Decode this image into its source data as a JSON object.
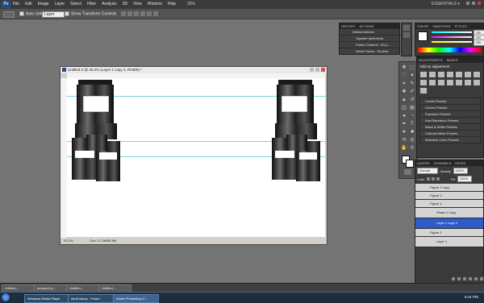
{
  "menubar": {
    "logo": "Ps",
    "items": [
      "File",
      "Edit",
      "Image",
      "Layer",
      "Select",
      "Filter",
      "Analysis",
      "3D",
      "View",
      "Window",
      "Help"
    ],
    "zoom": "25%",
    "workspace": "ESSENTIALS ▾"
  },
  "optbar": {
    "auto_select_label": "Auto-Select:",
    "auto_select_value": "Layer",
    "show_transform_label": "Show Transform Controls"
  },
  "doc": {
    "title": "Untitled-3 @ 25.2% (Layer 1 copy 3, RGB/8) *",
    "zoom_status": "25.2%",
    "doc_status": "Doc: 17.3M/85.8M"
  },
  "actions_panel": {
    "tabs": [
      "HISTORY",
      "ACTIONS"
    ],
    "items": [
      "Default Actions",
      "Vignette (selection)",
      "Frame Channel - 50 p...",
      "Wood Frame - 50 pixel"
    ]
  },
  "color_panel": {
    "tabs": [
      "COLOR",
      "SWATCHES",
      "STYLES"
    ],
    "r": "255",
    "g": "255",
    "b": "255"
  },
  "adjustments_panel": {
    "tabs": [
      "ADJUSTMENTS",
      "MASKS"
    ],
    "heading": "Add an adjustment",
    "presets": [
      "Levels Presets",
      "Curves Presets",
      "Exposure Presets",
      "Hue/Saturation Presets",
      "Black & White Presets",
      "Channel Mixer Presets",
      "Selective Color Presets"
    ]
  },
  "layers_panel": {
    "tabs": [
      "LAYERS",
      "CHANNELS",
      "PATHS"
    ],
    "blend_mode": "Normal",
    "opacity_label": "Opacity:",
    "opacity": "100%",
    "lock_label": "Lock:",
    "fill_label": "Fill:",
    "fill": "100%",
    "layers": [
      "Figure 2 copy",
      "Figure 2",
      "Figure 1",
      "Shape 2 copy",
      "Layer 1 copy 3",
      "Figure 1",
      "Layer 1"
    ]
  },
  "doc_tabs": [
    "Untitled-...",
    "prospect-pi...",
    "Untitled-...",
    "Untitled-..."
  ],
  "taskbar": {
    "items": [
      "Windows Media Player",
      "shutf.ashop - Power...",
      "Adobe Photoshop C..."
    ],
    "clock": "6:41 PM"
  },
  "colors": {
    "bg": "#747474",
    "selected_row": "#2d5bc7",
    "accent": "#1d4f8c"
  }
}
